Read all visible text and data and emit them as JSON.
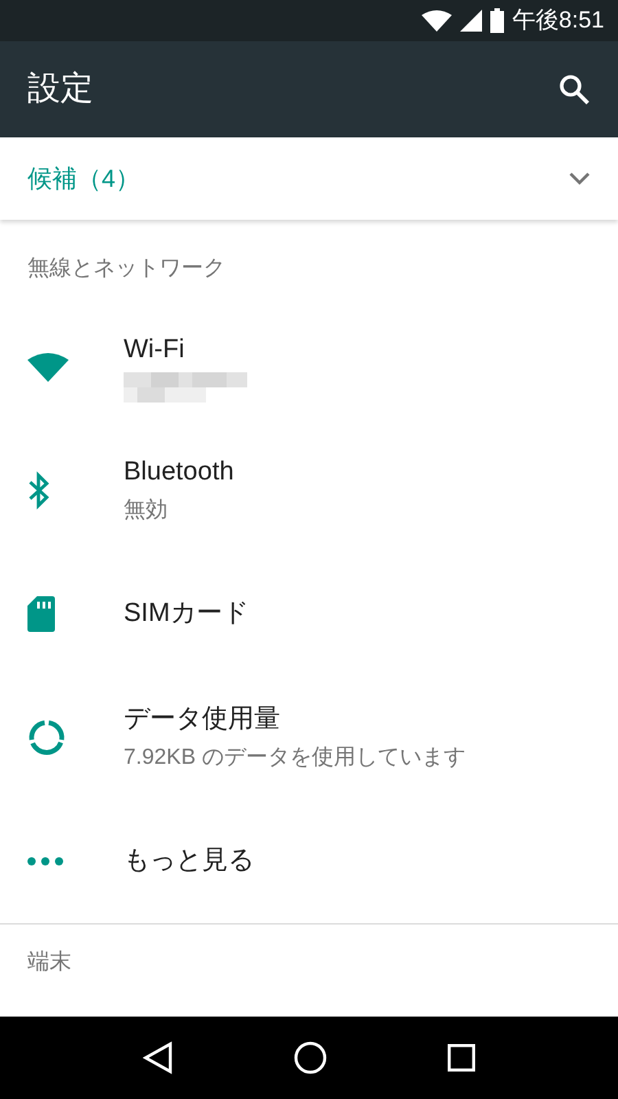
{
  "status_bar": {
    "time": "午後8:51"
  },
  "toolbar": {
    "title": "設定"
  },
  "suggestions": {
    "label": "候補（4）",
    "expanded": false
  },
  "sections": [
    {
      "header": "無線とネットワーク",
      "items": [
        {
          "kind": "wifi",
          "title": "Wi-Fi",
          "summary_redacted": true
        },
        {
          "kind": "bluetooth",
          "title": "Bluetooth",
          "summary": "無効"
        },
        {
          "kind": "sim",
          "title": "SIMカード"
        },
        {
          "kind": "data",
          "title": "データ使用量",
          "summary": "7.92KB のデータを使用しています"
        },
        {
          "kind": "more",
          "title": "もっと見る"
        }
      ]
    },
    {
      "header": "端末"
    }
  ]
}
